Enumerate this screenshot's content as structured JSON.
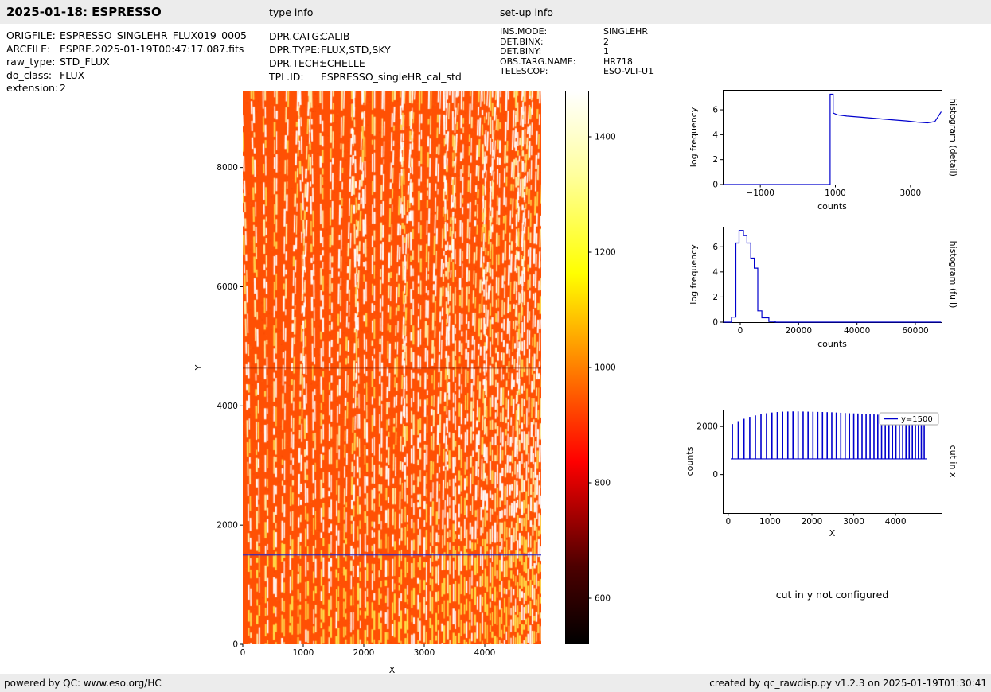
{
  "header": {
    "title": "2025-01-18: ESPRESSO",
    "type_info_label": "type info",
    "setup_info_label": "set-up info"
  },
  "file_info": {
    "rows": [
      {
        "label": "ORIGFILE:",
        "value": "ESPRESSO_SINGLEHR_FLUX019_0005"
      },
      {
        "label": "ARCFILE:",
        "value": "ESPRE.2025-01-19T00:47:17.087.fits"
      },
      {
        "label": "raw_type:",
        "value": "STD_FLUX"
      },
      {
        "label": "do_class:",
        "value": "FLUX"
      },
      {
        "label": "extension:",
        "value": "2"
      }
    ]
  },
  "type_info": {
    "rows": [
      {
        "label": "DPR.CATG:",
        "value": "CALIB"
      },
      {
        "label": "DPR.TYPE:",
        "value": "FLUX,STD,SKY"
      },
      {
        "label": "DPR.TECH:",
        "value": "ECHELLE"
      },
      {
        "label": "TPL.ID:",
        "value": "ESPRESSO_singleHR_cal_std"
      }
    ]
  },
  "setup_info": {
    "rows": [
      {
        "label": "INS.MODE:",
        "value": "SINGLEHR"
      },
      {
        "label": "DET.BINX:",
        "value": "2"
      },
      {
        "label": "DET.BINY:",
        "value": "1"
      },
      {
        "label": "OBS.TARG.NAME:",
        "value": "HR718"
      },
      {
        "label": "TELESCOP:",
        "value": "ESO-VLT-U1"
      }
    ]
  },
  "not_configured_note": "cut in y not configured",
  "footer": {
    "left": "powered by QC: www.eso.org/HC",
    "right": "created by qc_rawdisp.py v1.2.3 on 2025-01-19T01:30:41"
  },
  "chart_data": [
    {
      "id": "raw-frame",
      "type": "heatmap",
      "xlabel": "X",
      "ylabel": "Y",
      "xlim": [
        0,
        4934
      ],
      "ylim": [
        0,
        9290
      ],
      "xticks": [
        0,
        1000,
        2000,
        3000,
        4000
      ],
      "yticks": [
        0,
        2000,
        4000,
        6000,
        8000
      ],
      "colormap": "hot",
      "base_color": "#ff5004",
      "base_level_counts": 1000,
      "cut_line_y": 1500,
      "cut_line_color": "#2626c9",
      "dark_row_y": 4640,
      "colorbar": {
        "ticks": [
          600,
          800,
          1000,
          1200,
          1400
        ],
        "vmin": 520,
        "vmax": 1480
      }
    },
    {
      "id": "hist-detail",
      "type": "line",
      "xlabel": "counts",
      "ylabel": "log frequency",
      "right_label": "histogram (detail)",
      "color": "#0000cd",
      "xlim": [
        -2000,
        3830
      ],
      "ylim": [
        0,
        7.6
      ],
      "xticks": [
        -1000,
        1000,
        3000
      ],
      "yticks": [
        0,
        2,
        4,
        6
      ],
      "points": [
        [
          -1990,
          0
        ],
        [
          860,
          0
        ],
        [
          860,
          7.25
        ],
        [
          940,
          7.25
        ],
        [
          940,
          5.75
        ],
        [
          1050,
          5.6
        ],
        [
          1300,
          5.5
        ],
        [
          1700,
          5.4
        ],
        [
          2100,
          5.3
        ],
        [
          2500,
          5.2
        ],
        [
          2900,
          5.1
        ],
        [
          3200,
          5.0
        ],
        [
          3450,
          4.95
        ],
        [
          3650,
          5.05
        ],
        [
          3820,
          5.85
        ]
      ]
    },
    {
      "id": "hist-full",
      "type": "line",
      "xlabel": "counts",
      "ylabel": "log frequency",
      "right_label": "histogram (full)",
      "color": "#0000cd",
      "xlim": [
        -6000,
        69000
      ],
      "ylim": [
        0,
        7.6
      ],
      "xticks": [
        0,
        20000,
        40000,
        60000
      ],
      "yticks": [
        0,
        2,
        4,
        6
      ],
      "points": [
        [
          -5800,
          0
        ],
        [
          -3000,
          0
        ],
        [
          -3000,
          0.4
        ],
        [
          -1500,
          0.4
        ],
        [
          -1500,
          6.3
        ],
        [
          -400,
          6.3
        ],
        [
          -400,
          7.3
        ],
        [
          1100,
          7.3
        ],
        [
          1100,
          6.9
        ],
        [
          2300,
          6.9
        ],
        [
          2300,
          6.3
        ],
        [
          3600,
          6.3
        ],
        [
          3600,
          5.1
        ],
        [
          4800,
          5.1
        ],
        [
          4800,
          4.3
        ],
        [
          6000,
          4.3
        ],
        [
          6000,
          0.9
        ],
        [
          7400,
          0.9
        ],
        [
          7400,
          0.35
        ],
        [
          9800,
          0.35
        ],
        [
          9800,
          0.05
        ],
        [
          12000,
          0.05
        ],
        [
          12000,
          0
        ],
        [
          68800,
          0
        ]
      ]
    },
    {
      "id": "cut-in-x",
      "type": "spikes",
      "xlabel": "X",
      "ylabel": "counts",
      "right_label": "cut in x",
      "legend_label": "y=1500",
      "color": "#0000cd",
      "xlim": [
        -130,
        5100
      ],
      "ylim": [
        -1600,
        2700
      ],
      "xticks": [
        0,
        1000,
        2000,
        3000,
        4000
      ],
      "yticks": [
        0,
        2000
      ],
      "baseline": 650,
      "spikes": [
        [
          100,
          2100
        ],
        [
          240,
          2220
        ],
        [
          378,
          2320
        ],
        [
          515,
          2400
        ],
        [
          650,
          2460
        ],
        [
          783,
          2510
        ],
        [
          915,
          2550
        ],
        [
          1045,
          2580
        ],
        [
          1173,
          2600
        ],
        [
          1300,
          2615
        ],
        [
          1425,
          2620
        ],
        [
          1548,
          2625
        ],
        [
          1670,
          2625
        ],
        [
          1790,
          2620
        ],
        [
          1908,
          2615
        ],
        [
          2025,
          2610
        ],
        [
          2140,
          2605
        ],
        [
          2253,
          2600
        ],
        [
          2365,
          2595
        ],
        [
          2475,
          2590
        ],
        [
          2583,
          2580
        ],
        [
          2690,
          2570
        ],
        [
          2795,
          2560
        ],
        [
          2898,
          2550
        ],
        [
          3000,
          2545
        ],
        [
          3100,
          2540
        ],
        [
          3198,
          2530
        ],
        [
          3295,
          2520
        ],
        [
          3390,
          2510
        ],
        [
          3483,
          2500
        ],
        [
          3575,
          2490
        ],
        [
          3665,
          2480
        ],
        [
          3753,
          2470
        ],
        [
          3840,
          2460
        ],
        [
          3925,
          2450
        ],
        [
          4008,
          2440
        ],
        [
          4090,
          2430
        ],
        [
          4170,
          2420
        ],
        [
          4248,
          2410
        ],
        [
          4325,
          2400
        ],
        [
          4400,
          2390
        ],
        [
          4473,
          2380
        ],
        [
          4545,
          2370
        ],
        [
          4615,
          2360
        ],
        [
          4683,
          2350
        ]
      ]
    }
  ]
}
